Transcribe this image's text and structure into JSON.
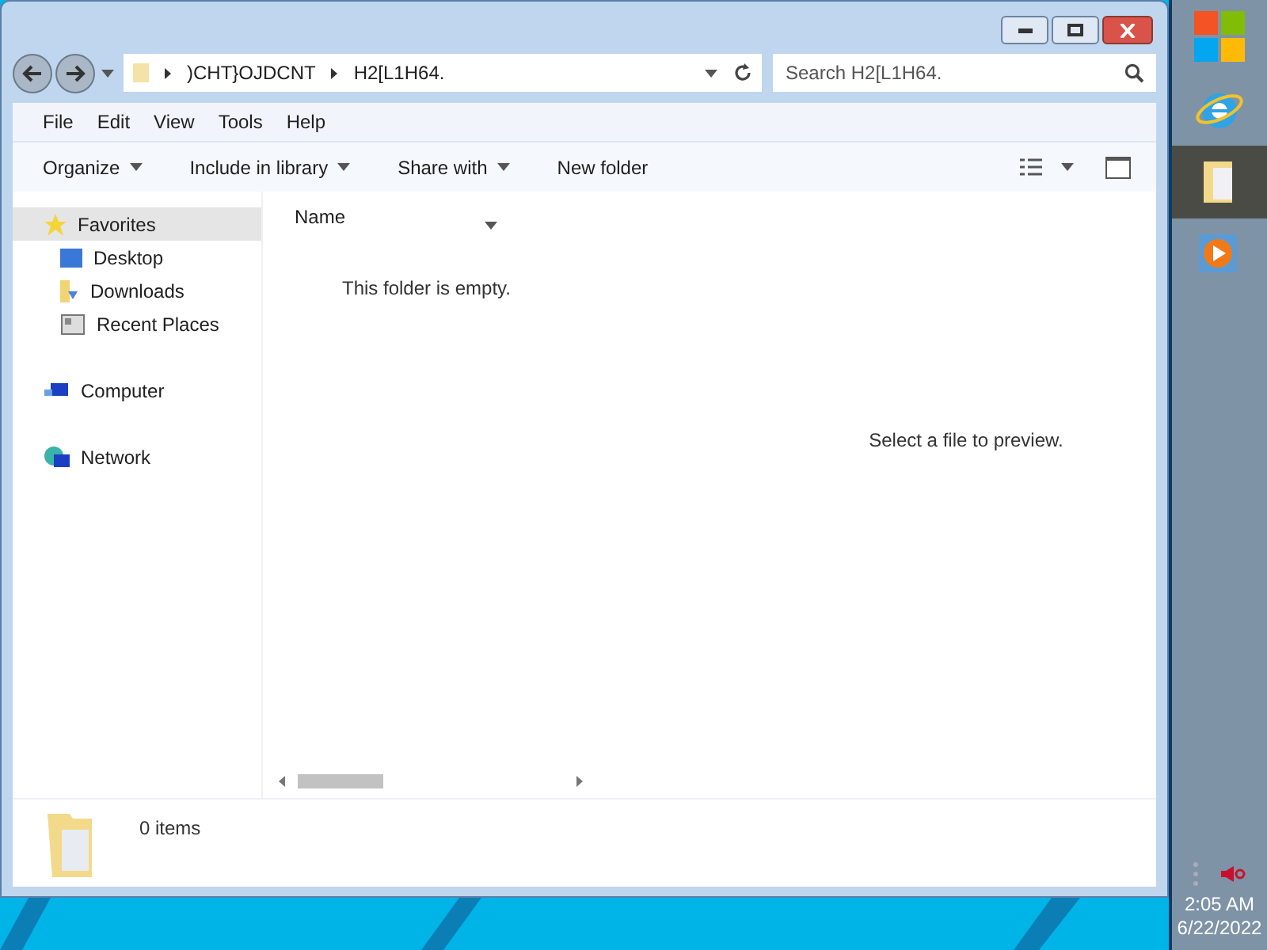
{
  "address_bar": {
    "segments": [
      ")CHT}OJDCNT",
      "H2[L1H64."
    ]
  },
  "search": {
    "placeholder": "Search H2[L1H64."
  },
  "menu_bar": [
    "File",
    "Edit",
    "View",
    "Tools",
    "Help"
  ],
  "toolbar": [
    {
      "label": "Organize",
      "dropdown": true
    },
    {
      "label": "Include in library",
      "dropdown": true
    },
    {
      "label": "Share with",
      "dropdown": true
    },
    {
      "label": "New folder",
      "dropdown": false
    }
  ],
  "navigation": [
    {
      "label": "Favorites",
      "kind": "favorites",
      "selected": true,
      "children": [
        {
          "label": "Desktop",
          "kind": "desktop",
          "selected": false
        },
        {
          "label": "Downloads",
          "kind": "downloads",
          "selected": false
        },
        {
          "label": "Recent Places",
          "kind": "recent",
          "selected": false
        }
      ]
    },
    {
      "label": "Computer",
      "kind": "computer",
      "selected": false
    },
    {
      "label": "Network",
      "kind": "network",
      "selected": false
    }
  ],
  "file_list": {
    "columns": [
      "Name"
    ],
    "empty_message": "This folder is empty."
  },
  "preview_pane": {
    "message": "Select a file to preview."
  },
  "details_pane": {
    "item_count": "0 items"
  },
  "taskbar": {
    "apps": [
      {
        "kind": "start",
        "active": false
      },
      {
        "kind": "browser",
        "active": false
      },
      {
        "kind": "explorer",
        "active": true
      },
      {
        "kind": "media",
        "active": false
      }
    ],
    "clock": {
      "time": "2:05 AM",
      "date": "6/22/2022"
    }
  }
}
